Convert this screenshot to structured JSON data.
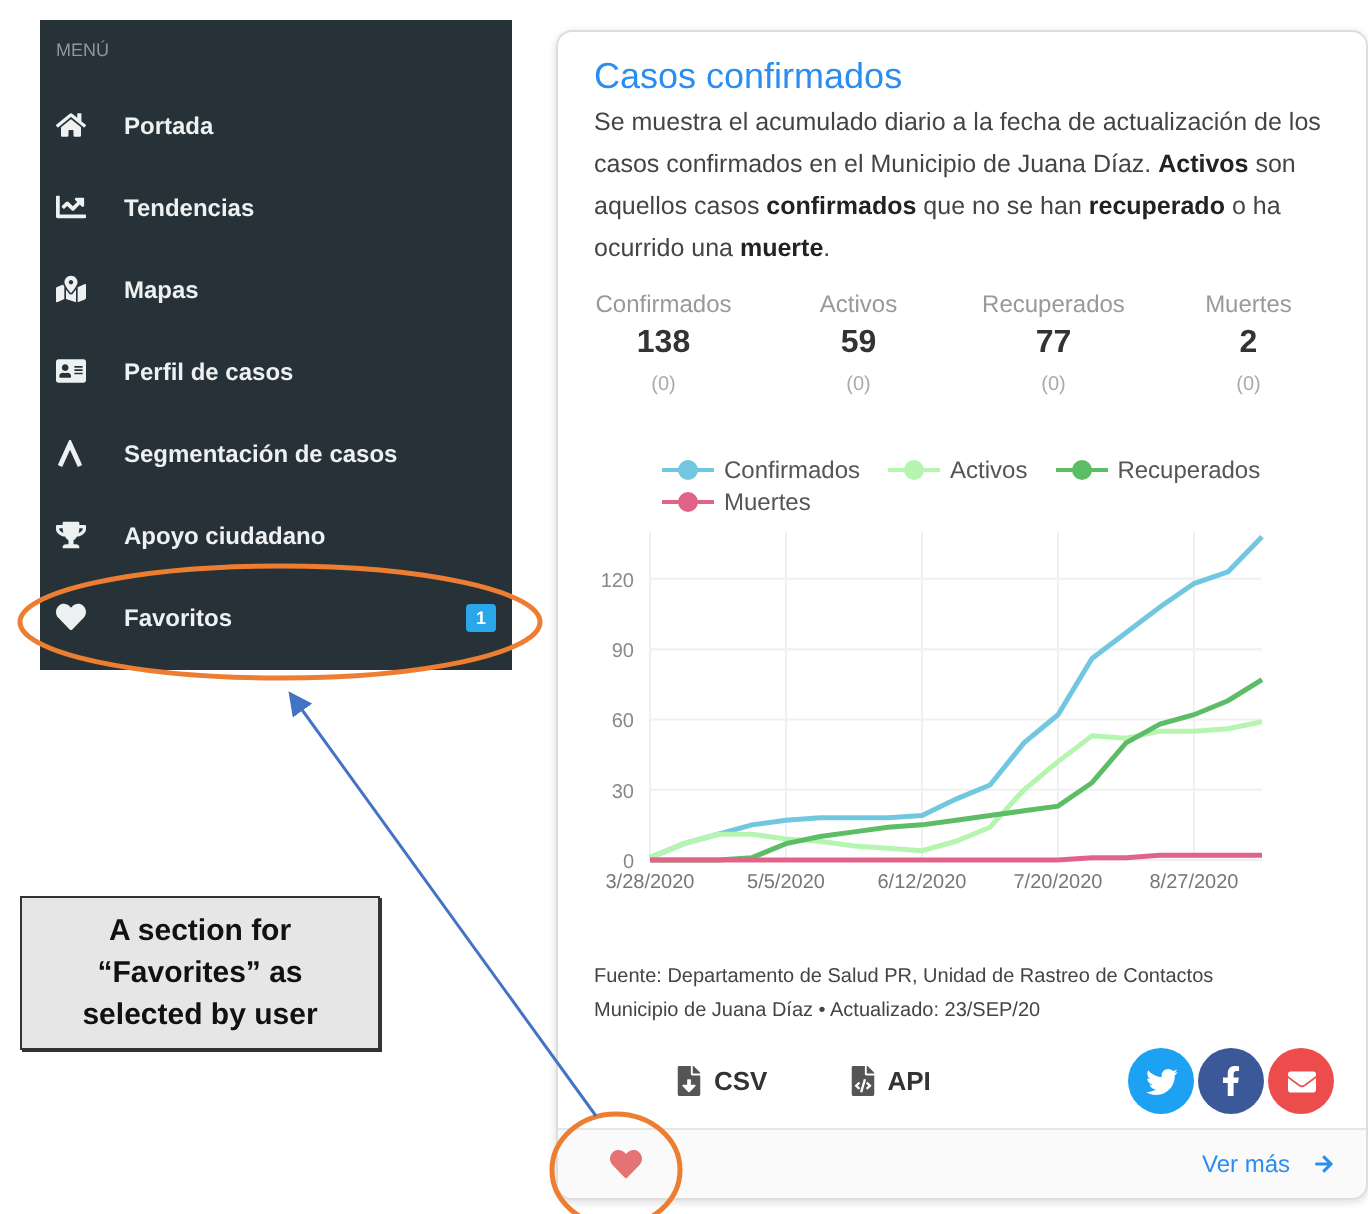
{
  "sidebar": {
    "heading": "MENÚ",
    "items": [
      {
        "label": "Portada"
      },
      {
        "label": "Tendencias"
      },
      {
        "label": "Mapas"
      },
      {
        "label": "Perfil de casos"
      },
      {
        "label": "Segmentación de casos"
      },
      {
        "label": "Apoyo ciudadano"
      },
      {
        "label": "Favoritos",
        "badge": "1"
      }
    ]
  },
  "callout": {
    "text": "A section for “Favorites” as selected by user"
  },
  "card": {
    "title": "Casos confirmados",
    "description": "Se muestra el acumulado diario a la fecha de actualización de los casos confirmados en el Municipio de Juana Díaz. **Activos** son aquellos casos **confirmados** que no se han **recuperado** o ha ocurrido una **muerte**.",
    "stats": [
      {
        "label": "Confirmados",
        "value": "138",
        "change": "(0)"
      },
      {
        "label": "Activos",
        "value": "59",
        "change": "(0)"
      },
      {
        "label": "Recuperados",
        "value": "77",
        "change": "(0)"
      },
      {
        "label": "Muertes",
        "value": "2",
        "change": "(0)"
      }
    ],
    "chart_data": {
      "type": "line",
      "categories": [
        "3/28/2020",
        null,
        null,
        null,
        "5/5/2020",
        null,
        null,
        null,
        "6/12/2020",
        null,
        null,
        null,
        "7/20/2020",
        null,
        null,
        null,
        "8/27/2020",
        null,
        null
      ],
      "ylim": [
        0,
        140
      ],
      "grid": true,
      "yticks": [
        0,
        30,
        60,
        90,
        120
      ],
      "series": [
        {
          "name": "Confirmados",
          "color": "#72c7e0",
          "values": [
            1,
            7,
            11,
            15,
            17,
            18,
            18,
            18,
            19,
            26,
            32,
            50,
            62,
            86,
            97,
            108,
            118,
            123,
            138
          ]
        },
        {
          "name": "Activos",
          "color": "#b5f5b0",
          "values": [
            1,
            7,
            11,
            11,
            9,
            8,
            6,
            5,
            4,
            8,
            14,
            30,
            42,
            53,
            52,
            55,
            55,
            56,
            59
          ]
        },
        {
          "name": "Recuperados",
          "color": "#5cbd66",
          "values": [
            0,
            0,
            0,
            1,
            7,
            10,
            12,
            14,
            15,
            17,
            19,
            21,
            23,
            33,
            50,
            58,
            62,
            68,
            77
          ]
        },
        {
          "name": "Muertes",
          "color": "#e0648a",
          "values": [
            0,
            0,
            0,
            0,
            0,
            0,
            0,
            0,
            0,
            0,
            0,
            0,
            0,
            1,
            1,
            2,
            2,
            2,
            2
          ]
        }
      ]
    },
    "source": [
      "Fuente: Departamento de Salud PR, Unidad de Rastreo de Contactos",
      "Municipio de Juana Díaz • Actualizado: 23/SEP/20"
    ],
    "downloads": [
      "CSV",
      "API"
    ],
    "favorited": true,
    "more_link": "Ver más"
  }
}
